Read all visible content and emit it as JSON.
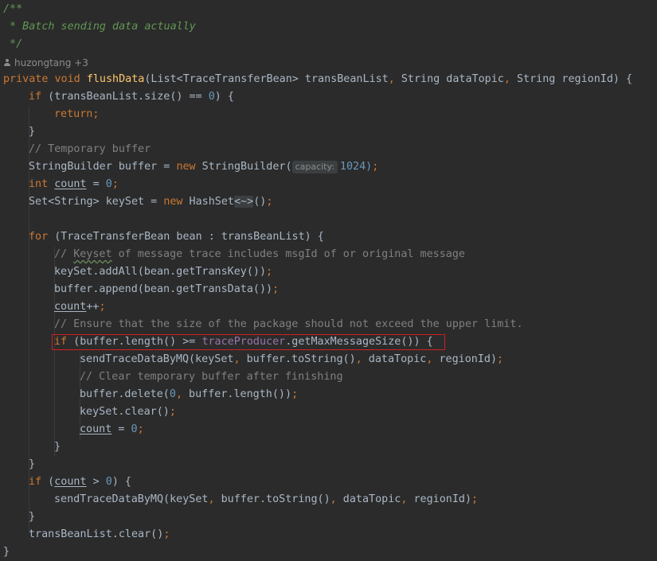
{
  "editor": {
    "author": "huzongtang +3",
    "inlay_hint": "capacity:",
    "fold_placeholder": "<~>",
    "code": [
      "/**",
      " * Batch sending data actually",
      " */",
      "private void flushData(List<TraceTransferBean> transBeanList, String dataTopic, String regionId) {",
      "if (transBeanList.size() == 0) {",
      "return;",
      "}",
      "// Temporary buffer",
      "StringBuilder buffer = new StringBuilder(",
      "1024);",
      "int count = 0;",
      "Set<String> keySet = new HashSet",
      "();",
      "for (TraceTransferBean bean : transBeanList) {",
      "// Keyset of message trace includes msgId of or original message",
      "keySet.addAll(bean.getTransKey());",
      "buffer.append(bean.getTransData());",
      "count++;",
      "// Ensure that the size of the package should not exceed the upper limit.",
      "if (buffer.length() >= traceProducer.getMaxMessageSize()) {",
      "sendTraceDataByMQ(keySet, buffer.toString(), dataTopic, regionId);",
      "// Clear temporary buffer after finishing",
      "buffer.delete(0, buffer.length());",
      "keySet.clear();",
      "count = 0;",
      "}",
      "}",
      "if (count > 0) {",
      "sendTraceDataByMQ(keySet, buffer.toString(), dataTopic, regionId);",
      "}",
      "transBeanList.clear();",
      "}"
    ]
  },
  "colors": {
    "background": "#2b2b2b",
    "keyword": "#cc7832",
    "doc_comment": "#629755",
    "comment": "#808080",
    "function": "#ffc66d",
    "number": "#6897bb",
    "field": "#9876aa",
    "highlight_border": "#d02020"
  }
}
